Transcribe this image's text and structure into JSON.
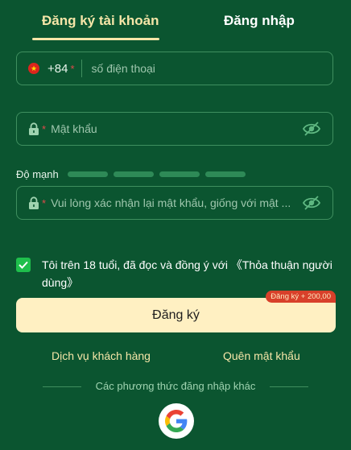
{
  "tabs": {
    "register": "Đăng ký tài khoản",
    "login": "Đăng nhập",
    "active": "register"
  },
  "phone": {
    "country_code": "+84",
    "required_mark": "*",
    "placeholder": "số điện thoại",
    "flag": "vietnam-flag-icon"
  },
  "password": {
    "required_mark": "*",
    "placeholder": "Mật khẩu"
  },
  "strength": {
    "label": "Độ mạnh",
    "segments": 4
  },
  "confirm": {
    "required_mark": "*",
    "placeholder": "Vui lòng xác nhận lại mật khẩu, giống với mật ..."
  },
  "agreement": {
    "checked": true,
    "text": "Tôi trên 18 tuổi, đã đọc và đồng ý với ",
    "link": "《Thỏa thuận người dùng》"
  },
  "submit": {
    "label": "Đăng ký",
    "bonus": "Đăng ký + 200,00"
  },
  "links": {
    "support": "Dịch vụ khách hàng",
    "forgot": "Quên mật khẩu"
  },
  "other_methods": {
    "label": "Các phương thức đăng nhập khác",
    "providers": [
      "google-icon"
    ]
  },
  "colors": {
    "background": "#0b5530",
    "accent": "#f5e6a8",
    "button": "#fff0c2",
    "badge": "#d8402a",
    "checkbox": "#1fbf4c"
  }
}
